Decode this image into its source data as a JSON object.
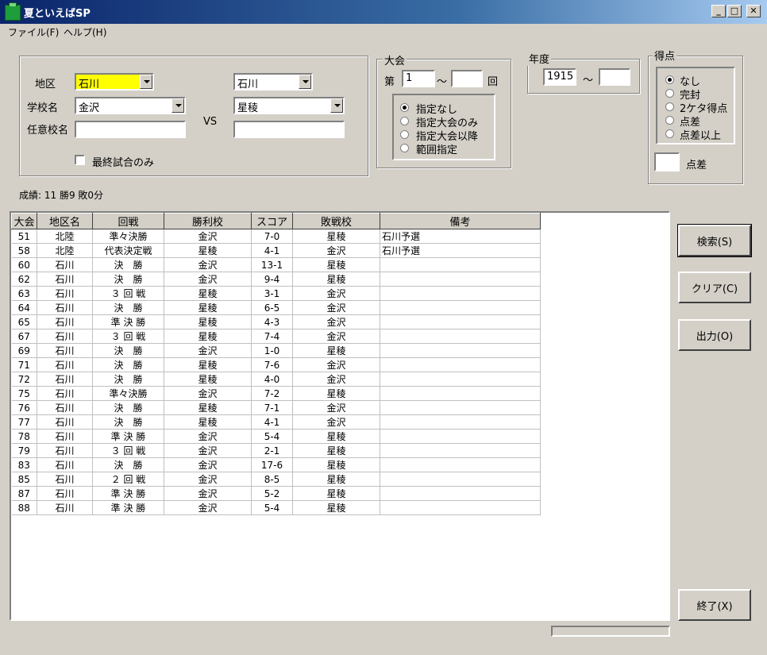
{
  "window": {
    "title": "夏といえばSP",
    "min": "_",
    "max": "□",
    "close": "✕"
  },
  "menu": {
    "file": "ファイル(F)",
    "help": "ヘルプ(H)"
  },
  "search": {
    "region_label": "地区",
    "region_left": "石川",
    "region_right": "石川",
    "school_label": "学校名",
    "school_left": "金沢",
    "school_right": "星稜",
    "free_label": "任意校名",
    "vs": "VS",
    "final_only": "最終試合のみ"
  },
  "tournament": {
    "title": "大会",
    "dai": "第",
    "from": "1",
    "tilde": "～",
    "to": "",
    "kai": "回",
    "options": [
      "指定なし",
      "指定大会のみ",
      "指定大会以降",
      "範囲指定"
    ],
    "selected": 0
  },
  "year": {
    "title": "年度",
    "from": "1915",
    "tilde": "～",
    "to": ""
  },
  "score": {
    "title": "得点",
    "options": [
      "なし",
      "完封",
      "2ケタ得点",
      "点差",
      "点差以上"
    ],
    "selected": 0,
    "diff_value": "",
    "diff_label": "点差"
  },
  "record": "成績: 11 勝9 敗0分",
  "table": {
    "headers": [
      "大会",
      "地区名",
      "回戦",
      "勝利校",
      "スコア",
      "敗戦校",
      "備考"
    ],
    "rows": [
      [
        "51",
        "北陸",
        "準々決勝",
        "金沢",
        "7-0",
        "星稜",
        "石川予選"
      ],
      [
        "58",
        "北陸",
        "代表決定戦",
        "星稜",
        "4-1",
        "金沢",
        "石川予選"
      ],
      [
        "60",
        "石川",
        "決　勝",
        "金沢",
        "13-1",
        "星稜",
        ""
      ],
      [
        "62",
        "石川",
        "決　勝",
        "金沢",
        "9-4",
        "星稜",
        ""
      ],
      [
        "63",
        "石川",
        "３ 回 戦",
        "星稜",
        "3-1",
        "金沢",
        ""
      ],
      [
        "64",
        "石川",
        "決　勝",
        "星稜",
        "6-5",
        "金沢",
        ""
      ],
      [
        "65",
        "石川",
        "準 決 勝",
        "星稜",
        "4-3",
        "金沢",
        ""
      ],
      [
        "67",
        "石川",
        "３ 回 戦",
        "星稜",
        "7-4",
        "金沢",
        ""
      ],
      [
        "69",
        "石川",
        "決　勝",
        "金沢",
        "1-0",
        "星稜",
        ""
      ],
      [
        "71",
        "石川",
        "決　勝",
        "星稜",
        "7-6",
        "金沢",
        ""
      ],
      [
        "72",
        "石川",
        "決　勝",
        "星稜",
        "4-0",
        "金沢",
        ""
      ],
      [
        "75",
        "石川",
        "準々決勝",
        "金沢",
        "7-2",
        "星稜",
        ""
      ],
      [
        "76",
        "石川",
        "決　勝",
        "星稜",
        "7-1",
        "金沢",
        ""
      ],
      [
        "77",
        "石川",
        "決　勝",
        "星稜",
        "4-1",
        "金沢",
        ""
      ],
      [
        "78",
        "石川",
        "準 決 勝",
        "金沢",
        "5-4",
        "星稜",
        ""
      ],
      [
        "79",
        "石川",
        "３ 回 戦",
        "金沢",
        "2-1",
        "星稜",
        ""
      ],
      [
        "83",
        "石川",
        "決　勝",
        "金沢",
        "17-6",
        "星稜",
        ""
      ],
      [
        "85",
        "石川",
        "２ 回 戦",
        "金沢",
        "8-5",
        "星稜",
        ""
      ],
      [
        "87",
        "石川",
        "準 決 勝",
        "金沢",
        "5-2",
        "星稜",
        ""
      ],
      [
        "88",
        "石川",
        "準 決 勝",
        "金沢",
        "5-4",
        "星稜",
        ""
      ]
    ]
  },
  "buttons": {
    "search": "検索(S)",
    "clear": "クリア(C)",
    "output": "出力(O)",
    "exit": "終了(X)"
  },
  "colors": {
    "highlight_field": "#ffff00",
    "titlebar": "#0a246a"
  }
}
